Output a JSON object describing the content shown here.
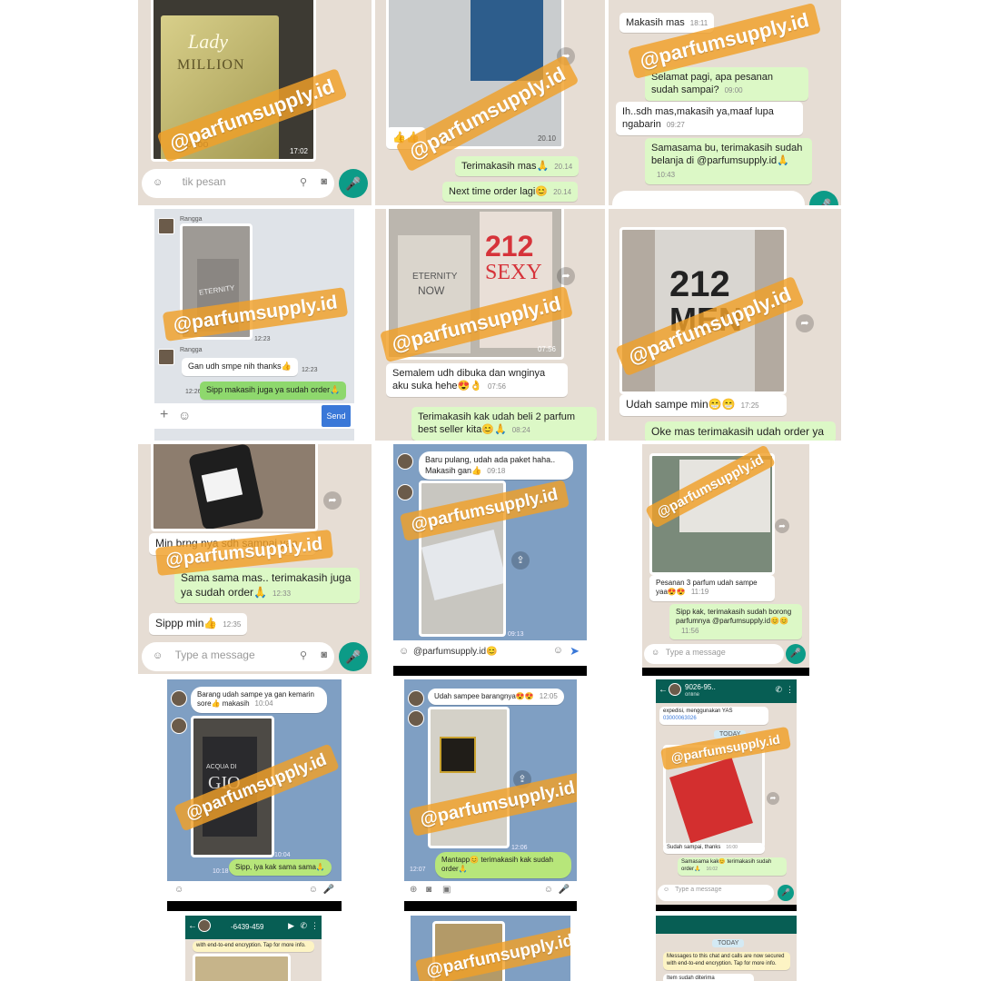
{
  "watermark": "@parfumsupply.id",
  "tiles": {
    "t1": {
      "product_text_1": "Lady",
      "product_text_2": "MILLION",
      "product_text_3": "pooo",
      "photo_time": "17:02",
      "input_placeholder": "tik pesan"
    },
    "t2": {
      "photo_time": "20.10",
      "emoji_msg": "👍👍",
      "msg1": "Terimakasih mas🙏",
      "msg1_time": "20.14",
      "msg2": "Next time order lagi😊",
      "msg2_time": "20.14"
    },
    "t3": {
      "msg1": "Makasih mas",
      "msg1_time": "18:11",
      "msg2": "Selamat pagi, apa pesanan sudah sampai?",
      "msg2_time": "09:00",
      "msg3": "Ih..sdh mas,makasih ya,maaf lupa ngabarin",
      "msg3_time": "09:27",
      "msg4": "Samasama bu, terimakasih sudah belanja di @parfumsupply.id🙏",
      "msg4_time": "10:43"
    },
    "t4": {
      "sender": "Rangga",
      "product_text": "ETERNITY",
      "photo_time": "12:23",
      "sender2": "Rangga",
      "msg1": "Gan udh smpe nih thanks👍",
      "msg1_time": "12:23",
      "msg2": "Sipp makasih juga ya sudah order🙏",
      "msg2_time": "12:26",
      "send_label": "Send"
    },
    "t5": {
      "product_text_1": "ETERNITY",
      "product_text_2": "NOW",
      "product_text_3": "212",
      "product_text_4": "SEXY",
      "photo_time": "07:56",
      "msg1": "Semalem udh dibuka dan wnginya aku suka hehe😍👌",
      "msg1_time": "07:56",
      "msg2": "Terimakasih kak udah beli 2 parfum best seller kita😊🙏",
      "msg2_time": "08:24"
    },
    "t6": {
      "product_text_1": "212",
      "product_text_2": "MEN",
      "msg1": "Udah sampe min😁😁",
      "msg1_time": "17:25",
      "msg2": "Oke mas terimakasih udah order ya"
    },
    "t7": {
      "msg1": "Min brng nya sdh sampai yaa",
      "msg2": "Sama sama mas.. terimakasih juga ya sudah order🙏",
      "msg2_time": "12:33",
      "msg3": "Sippp min👍",
      "msg3_time": "12:35",
      "input_placeholder": "Type a message"
    },
    "t8": {
      "msg1": "Baru pulang, udah ada paket haha.. Makasih gan👍",
      "msg1_time": "09:18",
      "photo_time": "09:13",
      "input_text": "@parfumsupply.id😊"
    },
    "t9": {
      "msg1": "Pesanan 3 parfum udah sampe yaa😍😍",
      "msg1_time": "11:19",
      "msg2": "Sipp kak, terimakasih sudah borong parfumnya @parfumsupply.id😊😊",
      "msg2_time": "11:56",
      "input_placeholder": "Type a message"
    },
    "t10": {
      "msg1": "Barang udah sampe ya gan kemarin sore👍 makasih",
      "msg1_time": "10:04",
      "product_text_1": "ACQUA DI",
      "product_text_2": "GIO",
      "photo_time": "10:04",
      "msg2": "Sipp, iya kak sama sama🙏",
      "msg2_time": "10:18"
    },
    "t11": {
      "msg1": "Udah sampee barangnya😍😍",
      "msg1_time": "12:05",
      "photo_time": "12:06",
      "msg2": "Mantapp😊 terimakasih kak sudah order🙏",
      "msg2_time": "12:07"
    },
    "t12": {
      "header_number": "9026-95..",
      "header_sub": "online",
      "info_line": "expedisi, menggunakan YAS",
      "info_code": "03000063026",
      "today": "TODAY",
      "msg1": "Sudah sampai, thanks",
      "msg1_time": "16:00",
      "msg2": "Samasama kak😊 terimakasih sudah order🙏",
      "msg2_time": "16:02",
      "input_placeholder": "Type a message"
    },
    "t13": {
      "header_number": "-6439-459",
      "info_line": "with end-to-end encryption. Tap for more info."
    },
    "t15": {
      "today": "TODAY",
      "info_line": "Messages to this chat and calls are now secured with end-to-end encryption. Tap for more info.",
      "msg_partial": "Item sudah diterima"
    }
  }
}
